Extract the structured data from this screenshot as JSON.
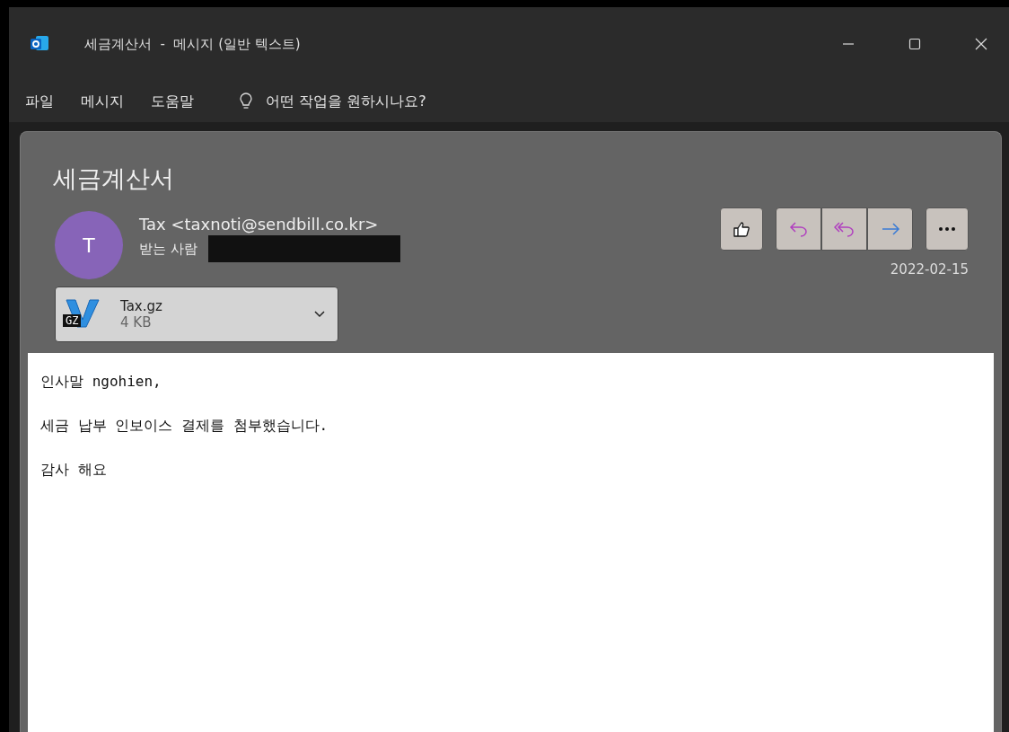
{
  "window": {
    "title": "세금계산서  -  메시지 (일반 텍스트)"
  },
  "menu": [
    "파일",
    "메시지",
    "도움말"
  ],
  "tell_me": {
    "placeholder": "어떤 작업을 원하시나요?"
  },
  "message": {
    "subject": "세금계산서",
    "avatar_initial": "T",
    "sender": "Tax <taxnoti@sendbill.co.kr>",
    "to_label": "받는 사람",
    "date": "2022-02-15",
    "attachment": {
      "badge": "GZ",
      "name": "Tax.gz",
      "size": "4 KB"
    },
    "body": [
      "인사말 ngohien,",
      "세금 납부 인보이스 결제를 첨부했습니다.",
      "감사 해요"
    ]
  }
}
